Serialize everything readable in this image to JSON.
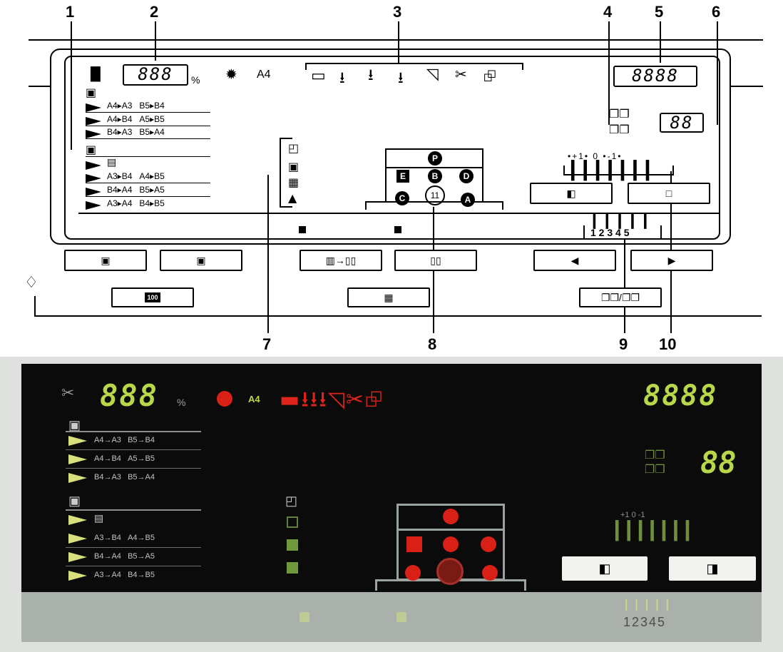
{
  "callouts": [
    "1",
    "2",
    "3",
    "4",
    "5",
    "6",
    "7",
    "8",
    "9",
    "10"
  ],
  "diagram": {
    "zoom_display": "888",
    "percent_sign": "%",
    "paper_size": "A4",
    "counter_display": "8888",
    "quantity_display": "88",
    "reduce_ratios": [
      [
        "A4▸A3",
        "B5▸B4"
      ],
      [
        "A4▸B4",
        "A5▸B5"
      ],
      [
        "B4▸A3",
        "B5▸A4"
      ]
    ],
    "enlarge_ratios": [
      [
        "A3▸B4",
        "A4▸B5"
      ],
      [
        "B4▸A4",
        "B5▸A5"
      ],
      [
        "A3▸A4",
        "B4▸B5"
      ]
    ],
    "position_letters": {
      "top": "P",
      "left_sq": "E",
      "center": "B",
      "right": "D",
      "bottom_left": "C",
      "center_ring": "11",
      "bottom_right": "A"
    },
    "density_scale": "•+1•  0  •-1•",
    "density_numbers": "1 2 3 4 5",
    "button_100": "100"
  },
  "photo": {
    "zoom_display": "888",
    "percent_sign": "%",
    "paper_size": "A4",
    "counter_display": "8888",
    "quantity_display": "88",
    "reduce_ratios": [
      [
        "A4→A3",
        "B5→B4"
      ],
      [
        "A4→B4",
        "A5→B5"
      ],
      [
        "B4→A3",
        "B5→A4"
      ]
    ],
    "enlarge_ratios": [
      [
        "A3→B4",
        "A4→B5"
      ],
      [
        "B4→A4",
        "B5→A5"
      ],
      [
        "A3→A4",
        "B4→B5"
      ]
    ],
    "density_scale": "+1   0   -1",
    "density_numbers": "12345"
  },
  "colors": {
    "led_green": "#b8d84a",
    "led_red": "#d82017",
    "panel_bg": "#0b0b0b"
  }
}
